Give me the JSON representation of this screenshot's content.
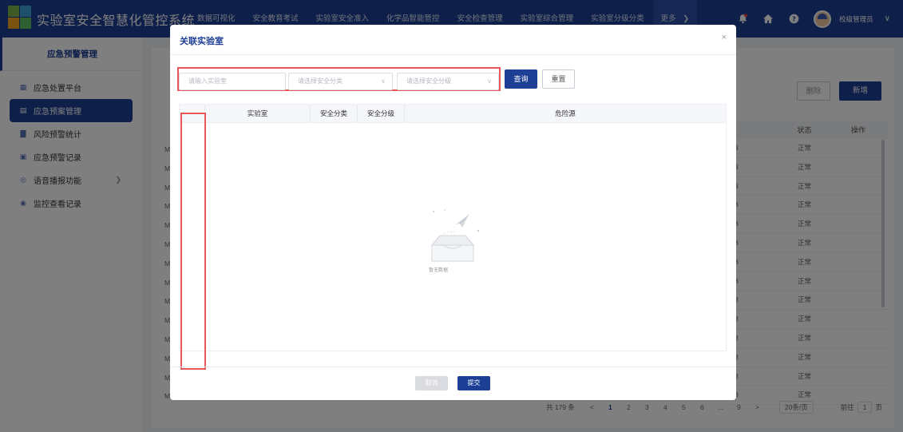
{
  "header": {
    "app_title": "实验室安全智慧化管控系统",
    "nav": [
      {
        "label": "数据可视化"
      },
      {
        "label": "安全教育考试"
      },
      {
        "label": "实验室安全准入"
      },
      {
        "label": "化学品智能管控"
      },
      {
        "label": "安全检查管理"
      },
      {
        "label": "实验室综合管理"
      },
      {
        "label": "实验室分级分类"
      }
    ],
    "more_label": "更多",
    "user_name": "校级管理员",
    "brand_color": "#1d3f95"
  },
  "sidebar": {
    "title": "应急预警管理",
    "items": [
      {
        "label": "应急处置平台",
        "icon": "grid-icon"
      },
      {
        "label": "应急预案管理",
        "icon": "doc-icon",
        "active": true
      },
      {
        "label": "风险预警统计",
        "icon": "bar-chart-icon"
      },
      {
        "label": "应急预警记录",
        "icon": "record-icon"
      },
      {
        "label": "语音播报功能",
        "icon": "voice-icon",
        "has_children": true
      },
      {
        "label": "监控查看记录",
        "icon": "camera-icon"
      }
    ]
  },
  "background": {
    "delete_label": "删除",
    "add_label": "新增",
    "table_headers": [
      "",
      "状态",
      "操作"
    ],
    "row_prefix": "M",
    "row_suffix": "8",
    "row_status": "正常",
    "pager": {
      "total": "共 179 条",
      "prev": "<",
      "pages": [
        "1",
        "2",
        "3",
        "4",
        "5",
        "6",
        "...",
        "9"
      ],
      "next": ">",
      "page_size": "20条/页",
      "goto_label": "前往",
      "goto_value": "1",
      "page_unit": "页"
    }
  },
  "modal": {
    "title": "关联实验室",
    "close": "×",
    "filters": {
      "lab_placeholder": "请输入实验室",
      "category_placeholder": "请选择安全分类",
      "level_placeholder": "请选择安全分级"
    },
    "query_label": "查询",
    "reset_label": "重置",
    "table_headers": {
      "lab": "实验室",
      "category": "安全分类",
      "level": "安全分级",
      "hazard": "危险源"
    },
    "empty_text": "暂无数据",
    "cancel_label": "取消",
    "submit_label": "提交"
  }
}
